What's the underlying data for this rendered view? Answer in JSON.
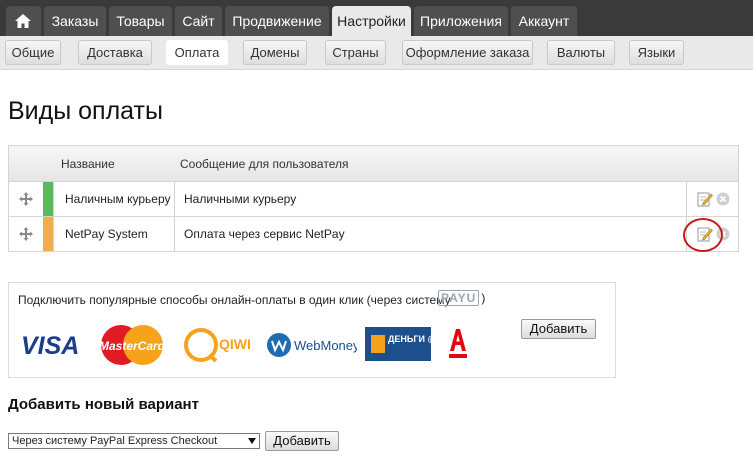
{
  "top_tabs": [
    "Заказы",
    "Товары",
    "Сайт",
    "Продвижение",
    "Настройки",
    "Приложения",
    "Аккаунт"
  ],
  "sub_tabs": [
    "Общие",
    "Доставка",
    "Оплата",
    "Домены",
    "Страны",
    "Оформление заказа",
    "Валюты",
    "Языки"
  ],
  "page_title": "Виды оплаты",
  "table": {
    "headers": [
      "Название",
      "Сообщение для пользователя"
    ],
    "rows": [
      {
        "name": "Наличным курьеру",
        "message": "Наличными курьеру",
        "color": "#5cb85c"
      },
      {
        "name": "NetPay System",
        "message": "Оплата через сервис NetPay",
        "color": "#f0ad4e"
      }
    ]
  },
  "payu": {
    "text": "Подключить популярные способы онлайн-оплаты в один клик (через систему",
    "logo": "PAYU",
    "close_paren": ")",
    "add_label": "Добавить",
    "logos": [
      "VISA",
      "MasterCard",
      "QIWI",
      "WebMoney",
      "ДЕНЬГИ @mail.ru",
      "Альфа-Банк"
    ]
  },
  "add_new": {
    "heading": "Добавить новый вариант",
    "select_value": "Через систему PayPal Express Checkout",
    "add_label": "Добавить"
  },
  "colors": {
    "accent_green": "#5cb85c",
    "accent_orange": "#f0ad4e",
    "highlight_red": "#c8191f"
  }
}
